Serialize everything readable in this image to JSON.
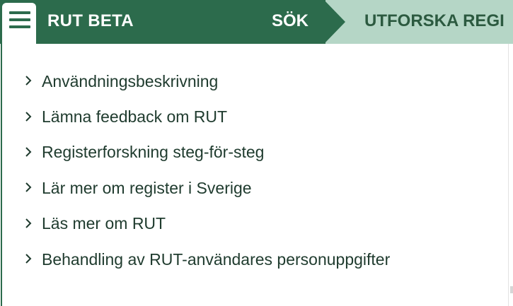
{
  "header": {
    "menu_icon": "hamburger-menu-icon",
    "brand": "RUT BETA",
    "nav": {
      "sok": "SÖK",
      "utforska": "UTFORSKA REGI"
    }
  },
  "dropdown": {
    "items": [
      {
        "label": "Användningsbeskrivning",
        "icon": "chevron-right-icon"
      },
      {
        "label": "Lämna feedback om RUT",
        "icon": "chevron-right-icon"
      },
      {
        "label": "Registerforskning steg-för-steg",
        "icon": "chevron-right-icon"
      },
      {
        "label": "Lär mer om register i Sverige",
        "icon": "chevron-right-icon"
      },
      {
        "label": "Läs mer om RUT",
        "icon": "chevron-right-icon"
      },
      {
        "label": "Behandling av RUT-användares personuppgifter",
        "icon": "chevron-right-icon"
      }
    ]
  },
  "colors": {
    "brand_green": "#2c6b4c",
    "light_green": "#b5d6c6",
    "text_dark": "#1f3b2e"
  }
}
